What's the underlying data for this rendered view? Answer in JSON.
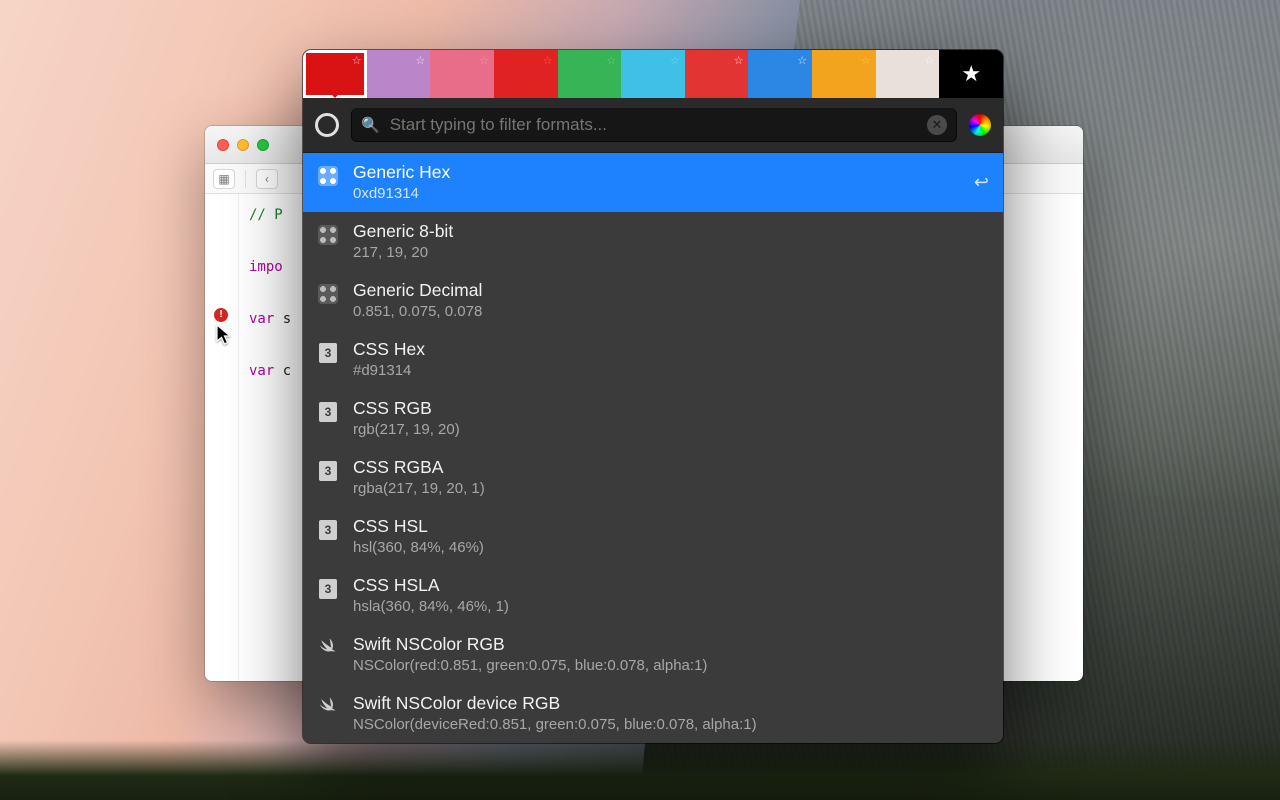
{
  "editor": {
    "code_comment": "// P",
    "code_import": "impo",
    "code_var1": "var ",
    "code_var1_rest": "s",
    "code_var2": "var ",
    "code_var2_rest": "c",
    "error_glyph": "!"
  },
  "popover": {
    "swatches": [
      {
        "hex": "#d91314",
        "fav": true,
        "selected": true
      },
      {
        "hex": "#bb85c9",
        "fav": true,
        "selected": false
      },
      {
        "hex": "#e86d89",
        "fav": false,
        "selected": false
      },
      {
        "hex": "#e02223",
        "fav": false,
        "selected": false
      },
      {
        "hex": "#37b455",
        "fav": false,
        "selected": false
      },
      {
        "hex": "#3fc0e7",
        "fav": false,
        "selected": false
      },
      {
        "hex": "#e33434",
        "fav": true,
        "selected": false
      },
      {
        "hex": "#2b87e3",
        "fav": true,
        "selected": false
      },
      {
        "hex": "#f3a41e",
        "fav": false,
        "selected": false
      },
      {
        "hex": "#e9e1d9",
        "fav": true,
        "selected": false
      }
    ],
    "star_tab_label": "★",
    "search_placeholder": "Start typing to filter formats...",
    "formats": [
      {
        "icon": "generic",
        "name": "Generic Hex",
        "value": "0xd91314",
        "selected": true
      },
      {
        "icon": "generic",
        "name": "Generic 8-bit",
        "value": "217, 19, 20"
      },
      {
        "icon": "generic",
        "name": "Generic Decimal",
        "value": "0.851, 0.075, 0.078"
      },
      {
        "icon": "css",
        "name": "CSS Hex",
        "value": "#d91314"
      },
      {
        "icon": "css",
        "name": "CSS RGB",
        "value": "rgb(217, 19, 20)"
      },
      {
        "icon": "css",
        "name": "CSS RGBA",
        "value": "rgba(217, 19, 20, 1)"
      },
      {
        "icon": "css",
        "name": "CSS HSL",
        "value": "hsl(360, 84%, 46%)"
      },
      {
        "icon": "css",
        "name": "CSS HSLA",
        "value": "hsla(360, 84%, 46%, 1)"
      },
      {
        "icon": "swift",
        "name": "Swift NSColor RGB",
        "value": "NSColor(red:0.851, green:0.075, blue:0.078, alpha:1)"
      },
      {
        "icon": "swift",
        "name": "Swift NSColor device RGB",
        "value": "NSColor(deviceRed:0.851, green:0.075, blue:0.078, alpha:1)"
      }
    ],
    "return_glyph": "↩",
    "css_badge_text": "3"
  }
}
